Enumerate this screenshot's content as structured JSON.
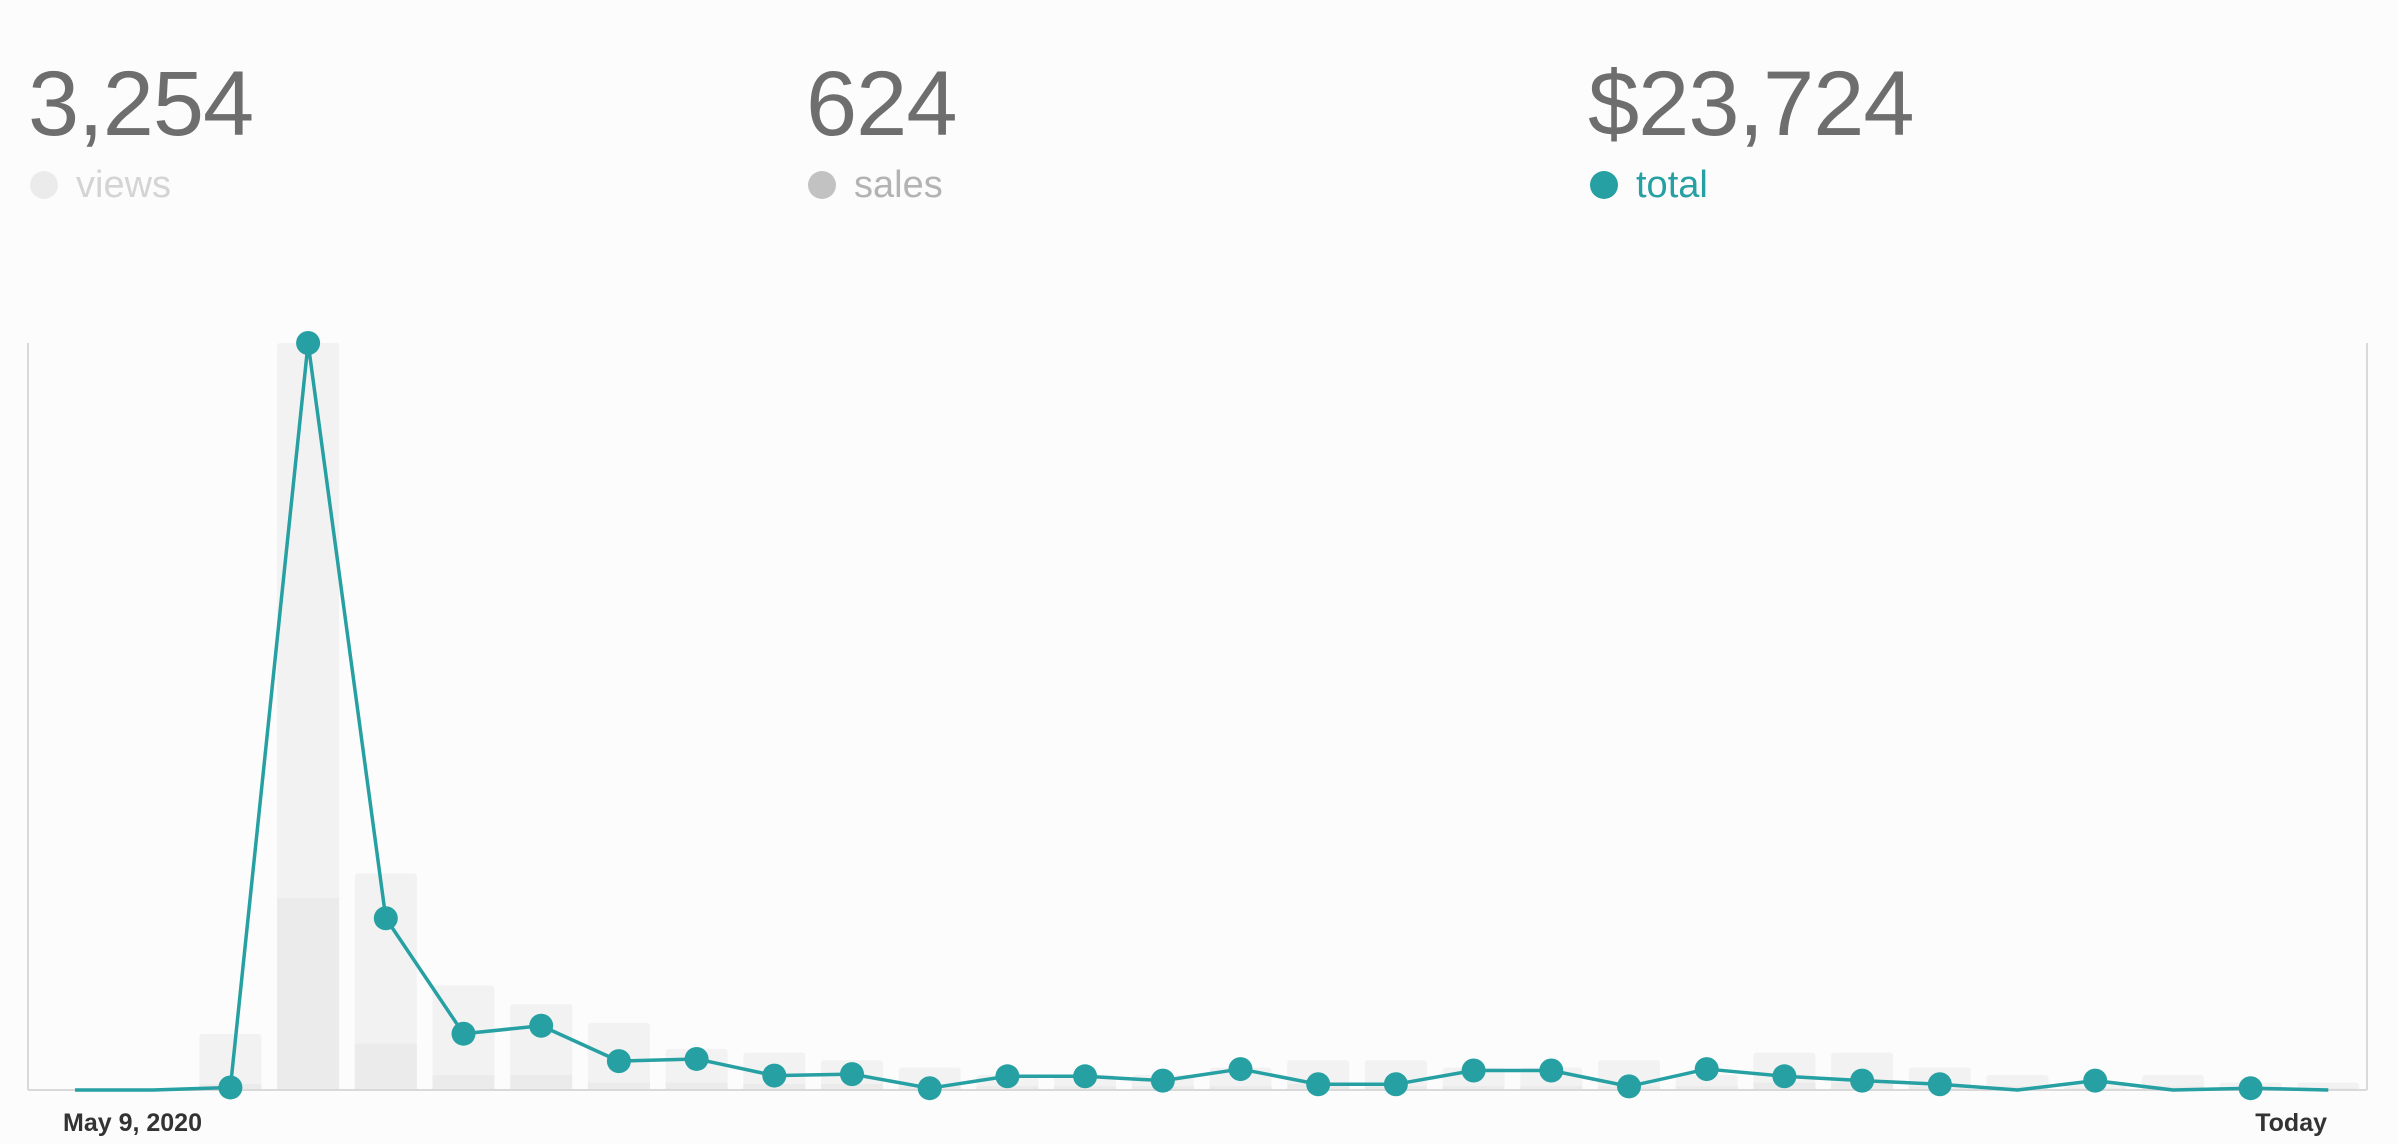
{
  "stats": [
    {
      "value": "3,254",
      "label": "views",
      "dot_color": "#ebebeb",
      "label_color": "#d4d4d4"
    },
    {
      "value": "624",
      "label": "sales",
      "dot_color": "#c2c2c2",
      "label_color": "#b3b3b3"
    },
    {
      "value": "$23,724",
      "label": "total",
      "dot_color": "#26a0a2",
      "label_color": "#26a0a2"
    }
  ],
  "chart_data": {
    "type": "bar",
    "x_start_label": "May 9, 2020",
    "x_end_label": "Today",
    "grid": false,
    "colors": {
      "views": "#f2f2f2",
      "sales": "#ebebeb",
      "total": "#26a0a2",
      "axis": "#d9d9d9"
    },
    "series": [
      {
        "name": "views",
        "values": [
          0,
          0,
          75,
          1000,
          290,
          140,
          115,
          90,
          55,
          50,
          40,
          30,
          20,
          20,
          20,
          30,
          40,
          40,
          30,
          30,
          40,
          20,
          50,
          50,
          30,
          20,
          10,
          20,
          10,
          10
        ]
      },
      {
        "name": "sales",
        "values": [
          0,
          0,
          8,
          257,
          62,
          20,
          20,
          10,
          10,
          8,
          8,
          5,
          5,
          5,
          5,
          5,
          8,
          5,
          5,
          5,
          5,
          5,
          10,
          10,
          5,
          5,
          2,
          5,
          2,
          2
        ]
      },
      {
        "name": "total",
        "values": [
          0,
          0,
          35,
          10350,
          2380,
          780,
          890,
          400,
          430,
          200,
          220,
          25,
          190,
          190,
          130,
          290,
          80,
          80,
          270,
          270,
          50,
          290,
          190,
          130,
          80,
          0,
          130,
          0,
          25,
          0
        ]
      }
    ]
  }
}
